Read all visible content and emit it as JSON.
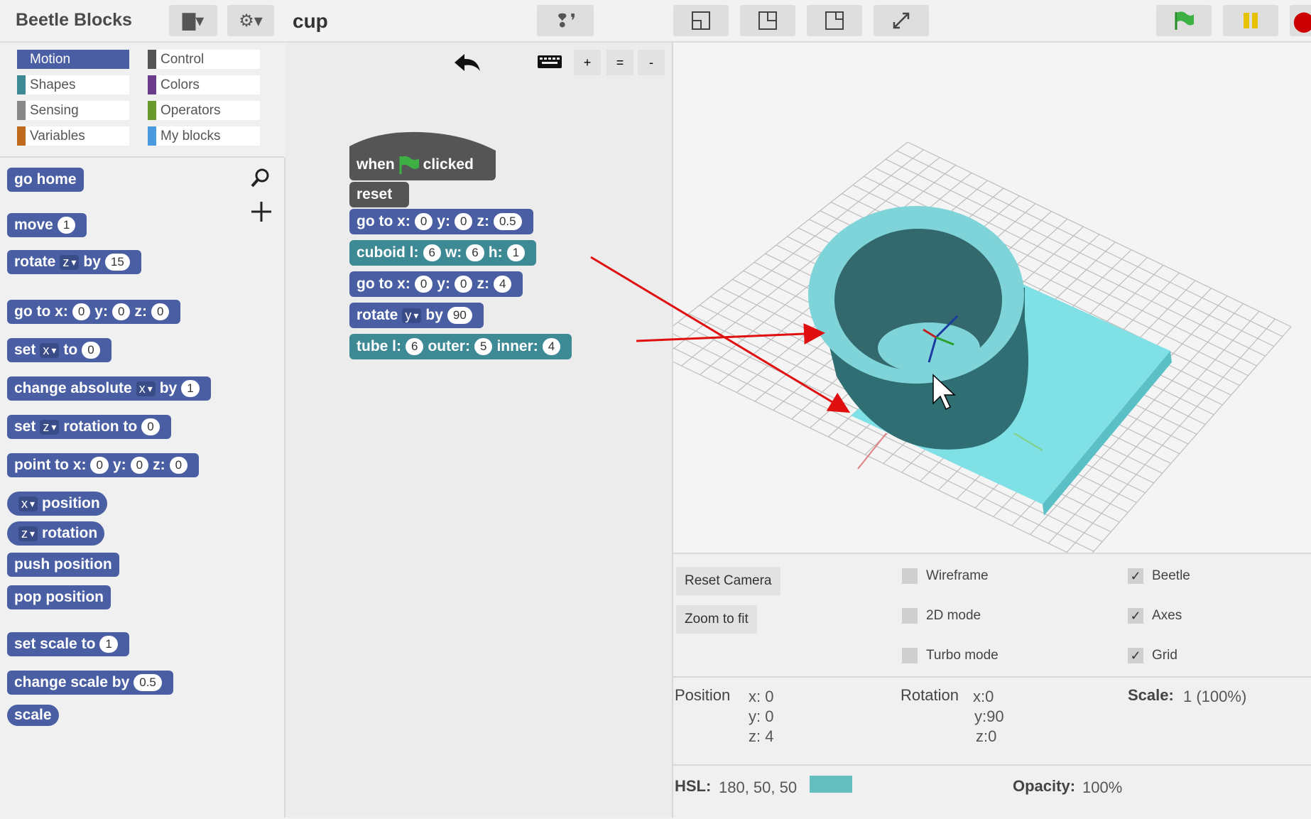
{
  "app": {
    "title": "Beetle Blocks",
    "project": "cup"
  },
  "topbar": {
    "file_icon": "file-icon",
    "settings_icon": "gear-icon",
    "beetle_icon": "footprints-icon",
    "layout_icons": [
      "layout-bottom-left-icon",
      "layout-top-right-icon",
      "layout-small-stage-icon",
      "fullscreen-icon"
    ],
    "green_flag_color": "#3cb043",
    "pause_color": "#e6c200"
  },
  "categories": [
    {
      "label": "Motion",
      "color": "#4a5fa3",
      "selected": true
    },
    {
      "label": "Control",
      "color": "#555555"
    },
    {
      "label": "Shapes",
      "color": "#3d8a95"
    },
    {
      "label": "Colors",
      "color": "#6b3c8c"
    },
    {
      "label": "Sensing",
      "color": "#888888"
    },
    {
      "label": "Operators",
      "color": "#6a9a2e"
    },
    {
      "label": "Variables",
      "color": "#c06a1e"
    },
    {
      "label": "My blocks",
      "color": "#4a9ae0"
    }
  ],
  "palette": {
    "go_home": "go home",
    "move": {
      "label": "move",
      "v": "1"
    },
    "rotate": {
      "label": "rotate",
      "axis": "z",
      "by": "by",
      "v": "15"
    },
    "goto": {
      "label": "go to x:",
      "x": "0",
      "ylab": "y:",
      "y": "0",
      "zlab": "z:",
      "z": "0"
    },
    "set": {
      "label": "set",
      "axis": "x",
      "to": "to",
      "v": "0"
    },
    "change_abs": {
      "label": "change absolute",
      "axis": "x",
      "by": "by",
      "v": "1"
    },
    "set_rot": {
      "label": "set",
      "axis": "z",
      "mid": "rotation to",
      "v": "0"
    },
    "point": {
      "label": "point to x:",
      "x": "0",
      "ylab": "y:",
      "y": "0",
      "zlab": "z:",
      "z": "0"
    },
    "xpos": {
      "axis": "x",
      "label": "position"
    },
    "zrot": {
      "axis": "z",
      "label": "rotation"
    },
    "push": "push position",
    "pop": "pop position",
    "set_scale": {
      "label": "set scale to",
      "v": "1"
    },
    "change_scale": {
      "label": "change scale by",
      "v": "0.5"
    },
    "scale": "scale"
  },
  "script_toolbar": {
    "undo_icon": "undo-icon",
    "keyboard_icon": "keyboard-icon",
    "plus": "+",
    "eq": "=",
    "minus": "-"
  },
  "script": {
    "hat": {
      "when": "when",
      "clicked": "clicked"
    },
    "reset": "reset",
    "goto1": {
      "label": "go to x:",
      "x": "0",
      "ylab": "y:",
      "y": "0",
      "zlab": "z:",
      "z": "0.5"
    },
    "cuboid": {
      "label": "cuboid l:",
      "l": "6",
      "wlab": "w:",
      "w": "6",
      "hlab": "h:",
      "h": "1"
    },
    "goto2": {
      "label": "go to x:",
      "x": "0",
      "ylab": "y:",
      "y": "0",
      "zlab": "z:",
      "z": "4"
    },
    "rotate": {
      "label": "rotate",
      "axis": "y",
      "by": "by",
      "v": "90"
    },
    "tube": {
      "label": "tube l:",
      "l": "6",
      "olab": "outer:",
      "o": "5",
      "ilab": "inner:",
      "i": "4"
    }
  },
  "controls": {
    "reset_camera": "Reset Camera",
    "zoom_fit": "Zoom to fit",
    "wireframe": "Wireframe",
    "mode2d": "2D mode",
    "turbo": "Turbo mode",
    "beetle": "Beetle",
    "axes": "Axes",
    "grid": "Grid",
    "check": "✓",
    "position_label": "Position",
    "px": "x: 0",
    "py": "y: 0",
    "pz": "z: 4",
    "rotation_label": "Rotation",
    "rx": "x:0",
    "ry": "y:90",
    "rz": "z:0",
    "scale_label": "Scale:",
    "scale_val": "1 (100%)",
    "hsl_label": "HSL:",
    "hsl_val": "180, 50, 50",
    "hsl_swatch": "#66bfbf",
    "opacity_label": "Opacity:",
    "opacity_val": "100%"
  }
}
